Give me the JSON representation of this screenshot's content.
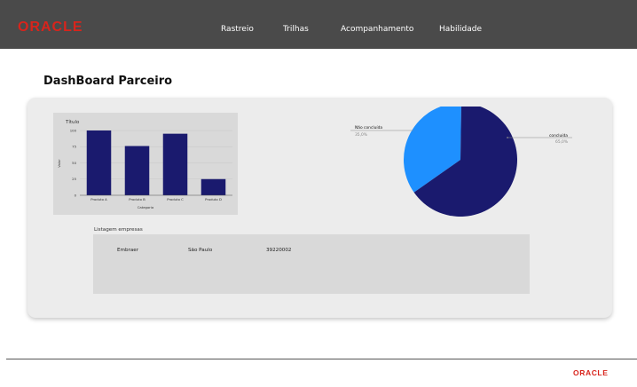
{
  "brand": {
    "logo_text": "ORACLE",
    "color": "#d8241c"
  },
  "nav": {
    "items": [
      {
        "label": "Rastreio"
      },
      {
        "label": "Trilhas"
      },
      {
        "label": "Acompanhamento"
      },
      {
        "label": "Habilidade"
      }
    ]
  },
  "page": {
    "title": "DashBoard Parceiro"
  },
  "chart_data": [
    {
      "type": "bar",
      "title": "Título",
      "xlabel": "Categoria",
      "ylabel": "Valor",
      "categories": [
        "Produto A",
        "Produto B",
        "Produto C",
        "Produto D"
      ],
      "values": [
        100,
        76,
        95,
        25
      ],
      "ylim": [
        0,
        100
      ],
      "yticks": [
        0,
        25,
        50,
        75,
        100
      ],
      "grid": true,
      "color": "#1a1a6e"
    },
    {
      "type": "pie",
      "slices": [
        {
          "label": "Não concluída",
          "percent_label": "35,0%",
          "value": 35.0,
          "color": "#1e90ff"
        },
        {
          "label": "concluída",
          "percent_label": "65,0%",
          "value": 65.0,
          "color": "#1a1a6e"
        }
      ]
    }
  ],
  "listing": {
    "label": "Listagem empresas",
    "rows": [
      {
        "name": "Embraer",
        "city": "São Paulo",
        "code": "39220002"
      }
    ]
  },
  "footer": {
    "logo_text": "ORACLE"
  }
}
